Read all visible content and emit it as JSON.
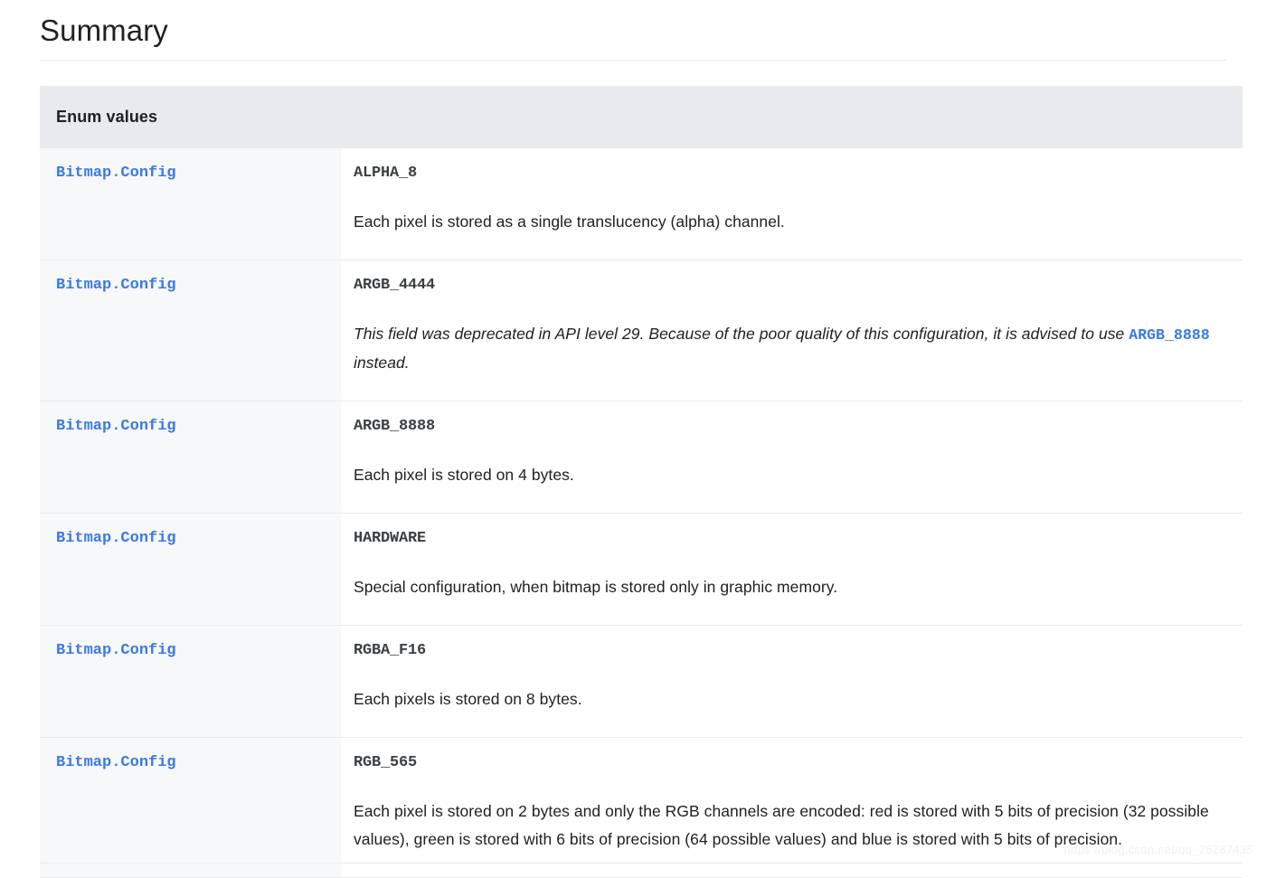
{
  "page": {
    "title": "Summary"
  },
  "table": {
    "header": "Enum values",
    "rows": [
      {
        "type": "Bitmap.Config",
        "name": "ALPHA_8",
        "description": "Each pixel is stored as a single translucency (alpha) channel.",
        "deprecated": false
      },
      {
        "type": "Bitmap.Config",
        "name": "ARGB_4444",
        "deprecated": true,
        "desc_part1": "This field was deprecated in API level 29. Because of the poor quality of this configuration, it is advised to use ",
        "desc_link": "ARGB_8888",
        "desc_part2": " instead."
      },
      {
        "type": "Bitmap.Config",
        "name": "ARGB_8888",
        "description": "Each pixel is stored on 4 bytes.",
        "deprecated": false
      },
      {
        "type": "Bitmap.Config",
        "name": "HARDWARE",
        "description": "Special configuration, when bitmap is stored only in graphic memory.",
        "deprecated": false
      },
      {
        "type": "Bitmap.Config",
        "name": "RGBA_F16",
        "description": "Each pixels is stored on 8 bytes.",
        "deprecated": false
      },
      {
        "type": "Bitmap.Config",
        "name": "RGB_565",
        "description": "Each pixel is stored on 2 bytes and only the RGB channels are encoded: red is stored with 5 bits of precision (32 possible values), green is stored with 6 bits of precision (64 possible values) and blue is stored with 5 bits of precision.",
        "deprecated": false
      }
    ]
  },
  "watermark": {
    "text": "https://blog.csdn.net/qq_26287435"
  },
  "colors": {
    "link": "#3b78e7",
    "header_bg": "#e8eaed",
    "row_divider": "#e8eaed",
    "type_cell_bg": "#f7f8f9",
    "body_text": "#202124",
    "const_text": "#3c4043"
  }
}
